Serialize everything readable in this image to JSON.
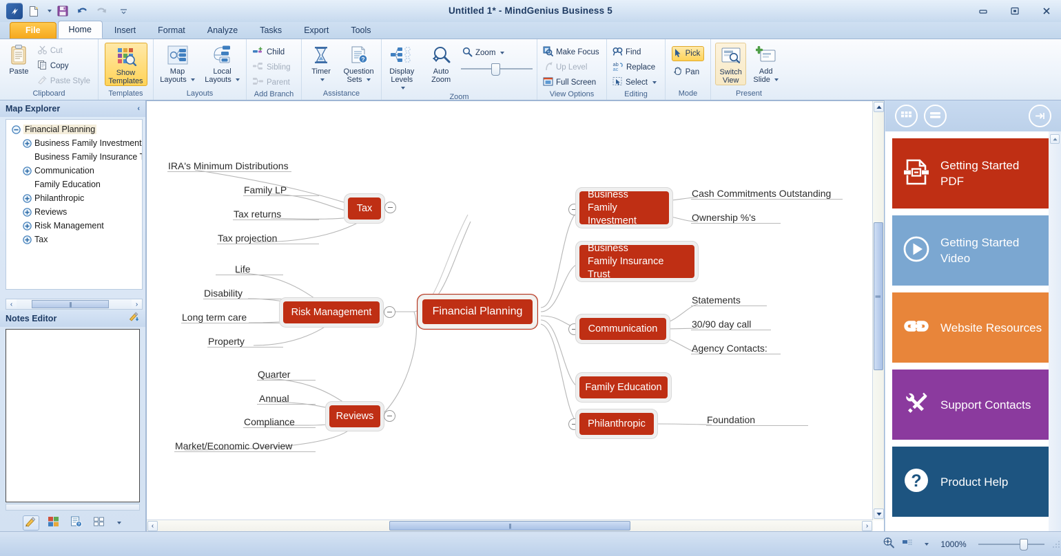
{
  "window": {
    "title": "Untitled 1* - MindGenius Business 5",
    "minimize": "—",
    "restore": "❐",
    "close": "✕"
  },
  "quick_access": {
    "app_button": "app-logo",
    "new": "new-document",
    "new_dropdown": "▾",
    "save": "save",
    "undo": "undo",
    "redo": "redo",
    "customize": "▾"
  },
  "tabs": [
    {
      "label": "File",
      "state": "file"
    },
    {
      "label": "Home",
      "state": "active"
    },
    {
      "label": "Insert",
      "state": "normal"
    },
    {
      "label": "Format",
      "state": "normal"
    },
    {
      "label": "Analyze",
      "state": "normal"
    },
    {
      "label": "Tasks",
      "state": "normal"
    },
    {
      "label": "Export",
      "state": "normal"
    },
    {
      "label": "Tools",
      "state": "normal"
    }
  ],
  "ribbon": {
    "groups": [
      {
        "name": "Clipboard",
        "label": "Clipboard",
        "big": [
          {
            "label": "Paste",
            "icon": "clipboard-icon"
          }
        ],
        "small": [
          {
            "label": "Cut",
            "icon": "scissors-icon",
            "disabled": true
          },
          {
            "label": "Copy",
            "icon": "copy-icon",
            "disabled": false
          },
          {
            "label": "Paste Style",
            "icon": "paste-style-icon",
            "disabled": true
          }
        ]
      },
      {
        "name": "Templates",
        "label": "Templates",
        "big": [
          {
            "label": "Show\nTemplates",
            "icon": "templates-icon",
            "selected": true
          }
        ]
      },
      {
        "name": "Layouts",
        "label": "Layouts",
        "big": [
          {
            "label": "Map\nLayouts",
            "icon": "map-layouts-icon",
            "dropdown": true
          },
          {
            "label": "Local\nLayouts",
            "icon": "local-layouts-icon",
            "dropdown": true
          }
        ]
      },
      {
        "name": "Add Branch",
        "label": "Add Branch",
        "small": [
          {
            "label": "Child",
            "icon": "child-branch-icon",
            "disabled": false
          },
          {
            "label": "Sibling",
            "icon": "sibling-branch-icon",
            "disabled": true
          },
          {
            "label": "Parent",
            "icon": "parent-branch-icon",
            "disabled": true
          }
        ]
      },
      {
        "name": "Assistance",
        "label": "Assistance",
        "big": [
          {
            "label": "Timer",
            "icon": "timer-icon",
            "dropdown": true
          },
          {
            "label": "Question\nSets",
            "icon": "question-sets-icon",
            "dropdown": true
          }
        ]
      },
      {
        "name": "Zoom",
        "label": "Zoom",
        "big": [
          {
            "label": "Display\nLevels",
            "icon": "display-levels-icon",
            "dropdown": true
          },
          {
            "label": "Auto\nZoom",
            "icon": "auto-zoom-icon"
          }
        ],
        "zoom_label": "Zoom",
        "zoom_icon": "magnifier-icon"
      },
      {
        "name": "View Options",
        "label": "View Options",
        "small": [
          {
            "label": "Make Focus",
            "icon": "make-focus-icon",
            "disabled": false
          },
          {
            "label": "Up Level",
            "icon": "up-level-icon",
            "disabled": true
          },
          {
            "label": "Full Screen",
            "icon": "full-screen-icon",
            "disabled": false
          }
        ]
      },
      {
        "name": "Editing",
        "label": "Editing",
        "small": [
          {
            "label": "Find",
            "icon": "find-icon",
            "disabled": false
          },
          {
            "label": "Replace",
            "icon": "replace-icon",
            "disabled": false
          },
          {
            "label": "Select",
            "icon": "select-icon",
            "disabled": false,
            "dropdown": true
          }
        ]
      },
      {
        "name": "Mode",
        "label": "Mode",
        "small": [
          {
            "label": "Pick",
            "icon": "cursor-arrow-icon",
            "selected": true
          },
          {
            "label": "Pan",
            "icon": "hand-icon",
            "disabled": false
          }
        ]
      },
      {
        "name": "Present",
        "label": "Present",
        "big": [
          {
            "label": "Switch\nView",
            "icon": "switch-view-icon",
            "soft": true
          },
          {
            "label": "Add\nSlide",
            "icon": "add-slide-icon",
            "dropdown": true
          }
        ]
      }
    ]
  },
  "map_explorer": {
    "title": "Map Explorer",
    "collapse_icon": "chevron-left-icon",
    "nodes": [
      {
        "label": "Financial Planning",
        "indent": 0,
        "expander": "minus",
        "selected": true
      },
      {
        "label": "Business Family Investment",
        "indent": 1,
        "expander": "plus",
        "selected": false
      },
      {
        "label": "Business Family Insurance T",
        "indent": 1,
        "expander": "none",
        "selected": false
      },
      {
        "label": "Communication",
        "indent": 1,
        "expander": "plus",
        "selected": false
      },
      {
        "label": "Family Education",
        "indent": 1,
        "expander": "none",
        "selected": false
      },
      {
        "label": "Philanthropic",
        "indent": 1,
        "expander": "plus",
        "selected": false
      },
      {
        "label": "Reviews",
        "indent": 1,
        "expander": "plus",
        "selected": false
      },
      {
        "label": "Risk Management",
        "indent": 1,
        "expander": "plus",
        "selected": false
      },
      {
        "label": "Tax",
        "indent": 1,
        "expander": "plus",
        "selected": false
      }
    ],
    "scroll_left": "‹",
    "scroll_right": "›"
  },
  "notes_editor": {
    "title": "Notes Editor",
    "header_icon": "pencil-down-icon",
    "content": "",
    "toolbar": [
      {
        "icon": "pencil-icon",
        "selected": true
      },
      {
        "icon": "color-blocks-icon",
        "selected": false
      },
      {
        "icon": "question-list-icon",
        "selected": false
      },
      {
        "icon": "grid-icon",
        "selected": false
      },
      {
        "icon": "chevron-down-icon",
        "selected": false
      }
    ]
  },
  "map": {
    "root": {
      "label": "Financial Planning"
    },
    "branches": [
      {
        "label": "Tax",
        "side": "left",
        "collapsible": true,
        "children": [
          "IRA's Minimum Distributions",
          "Family LP",
          "Tax returns",
          "Tax projection"
        ]
      },
      {
        "label": "Risk Management",
        "side": "left",
        "collapsible": true,
        "children": [
          "Life",
          "Disability",
          "Long term care",
          "Property"
        ]
      },
      {
        "label": "Reviews",
        "side": "left",
        "collapsible": true,
        "children": [
          "Quarter",
          "Annual",
          "Compliance",
          "Market/Economic Overview"
        ]
      },
      {
        "label": "Business\nFamily Investment",
        "side": "right",
        "collapsible": true,
        "children": [
          "Cash Commitments Outstanding",
          "Ownership %'s"
        ]
      },
      {
        "label": "Business\nFamily Insurance Trust",
        "side": "right",
        "collapsible": false,
        "children": []
      },
      {
        "label": "Communication",
        "side": "right",
        "collapsible": true,
        "children": [
          "Statements",
          "30/90 day call",
          "Agency Contacts:"
        ]
      },
      {
        "label": "Family Education",
        "side": "right",
        "collapsible": false,
        "children": []
      },
      {
        "label": "Philanthropic",
        "side": "right",
        "collapsible": true,
        "children": [
          "Foundation"
        ]
      }
    ],
    "node_labels": {
      "tax": "Tax",
      "risk_management": "Risk Management",
      "reviews": "Reviews",
      "bfi_line1": "Business",
      "bfi_line2": "Family Investment",
      "bfit_line1": "Business",
      "bfit_line2": "Family Insurance Trust",
      "communication": "Communication",
      "family_education": "Family Education",
      "philanthropic": "Philanthropic",
      "root": "Financial Planning"
    },
    "leaves": {
      "ira": "IRA's Minimum Distributions",
      "family_lp": "Family LP",
      "tax_returns": "Tax returns",
      "tax_projection": "Tax projection",
      "life": "Life",
      "disability": "Disability",
      "long_term_care": "Long term care",
      "property": "Property",
      "quarter": "Quarter",
      "annual": "Annual",
      "compliance": "Compliance",
      "market": "Market/Economic Overview",
      "cash": "Cash Commitments Outstanding",
      "ownership": "Ownership %'s",
      "statements": "Statements",
      "day_call": "30/90 day call",
      "agency": "Agency Contacts:",
      "foundation": "Foundation"
    },
    "node_color": "#bf2f14"
  },
  "right_panel": {
    "header": {
      "grid_icon": "grid-view-icon",
      "list_icon": "list-view-icon",
      "collapse_icon": "collapse-panel-icon"
    },
    "tiles": [
      {
        "label": "Getting Started\nPDF",
        "line1": "Getting Started",
        "line2": "PDF",
        "color": "#bf2f14",
        "icon": "pdf-document-icon"
      },
      {
        "label": "Getting Started\nVideo",
        "line1": "Getting Started",
        "line2": "Video",
        "color": "#7ba7d1",
        "icon": "play-circle-icon"
      },
      {
        "label": "Website Resources",
        "line1": "Website Resources",
        "line2": "",
        "color": "#e8853a",
        "icon": "link-chain-icon"
      },
      {
        "label": "Support Contacts",
        "line1": "Support Contacts",
        "line2": "",
        "color": "#8b3a9e",
        "icon": "tools-icon"
      },
      {
        "label": "Product Help",
        "line1": "Product Help",
        "line2": "",
        "color": "#1d5480",
        "icon": "question-circle-icon"
      }
    ]
  },
  "status_bar": {
    "zoom_icon": "zoom-settings-icon",
    "view_icon": "view-mode-icon",
    "dropdown": "▾",
    "zoom_level": "1000%"
  }
}
